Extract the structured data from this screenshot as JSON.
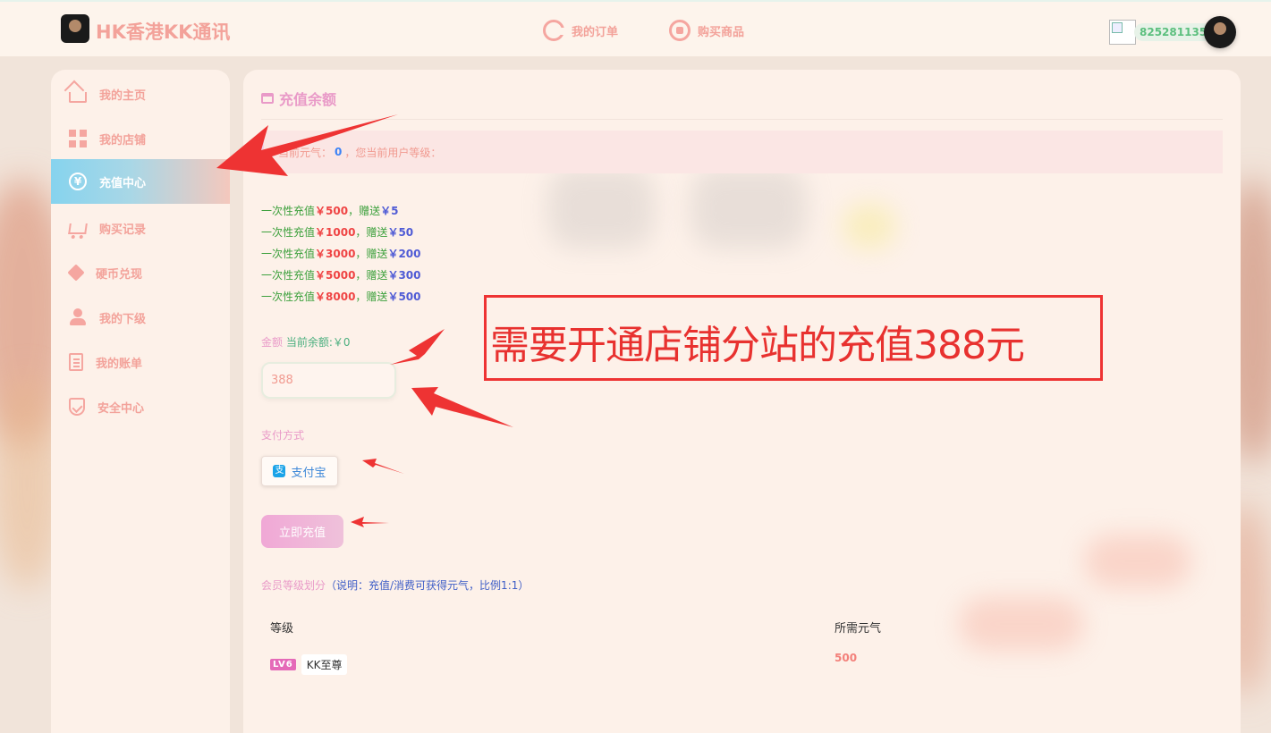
{
  "header": {
    "logo_text": "HK香港KK通讯",
    "nav": [
      {
        "label": "我的订单",
        "icon": "order-icon"
      },
      {
        "label": "购买商品",
        "icon": "cart-icon"
      }
    ],
    "user_id": "825281135"
  },
  "sidebar": {
    "items": [
      {
        "label": "我的主页",
        "icon": "home-icon",
        "active": false
      },
      {
        "label": "我的店铺",
        "icon": "store-icon",
        "active": false
      },
      {
        "label": "充值中心",
        "icon": "yen-icon",
        "active": true
      },
      {
        "label": "购买记录",
        "icon": "cart-icon",
        "active": false
      },
      {
        "label": "硬币兑现",
        "icon": "diamond-icon",
        "active": false
      },
      {
        "label": "我的下级",
        "icon": "person-icon",
        "active": false
      },
      {
        "label": "我的账单",
        "icon": "bill-icon",
        "active": false
      },
      {
        "label": "安全中心",
        "icon": "shield-icon",
        "active": false
      }
    ]
  },
  "main": {
    "title": "充值余额",
    "notice": {
      "prefix": "当前元气：",
      "value": "0",
      "suffix": "，您当前用户等级："
    },
    "promos": [
      {
        "text": "一次性充值",
        "amount": "￥500",
        "mid": "，赠送",
        "bonus": "￥5"
      },
      {
        "text": "一次性充值",
        "amount": "￥1000",
        "mid": "，赠送",
        "bonus": "￥50"
      },
      {
        "text": "一次性充值",
        "amount": "￥3000",
        "mid": "，赠送",
        "bonus": "￥200"
      },
      {
        "text": "一次性充值",
        "amount": "￥5000",
        "mid": "，赠送",
        "bonus": "￥300"
      },
      {
        "text": "一次性充值",
        "amount": "￥8000",
        "mid": "，赠送",
        "bonus": "￥500"
      }
    ],
    "amount_label": "金额",
    "balance_label": "当前余额:￥0",
    "amount_value": "388",
    "pay_label": "支付方式",
    "pay_method": "支付宝",
    "submit_label": "立即充值",
    "level_title": "会员等级划分",
    "level_note": "（说明：充值/消费可获得元气，比例1:1）",
    "table_headers": [
      "等级",
      "所需元气"
    ],
    "levels": [
      {
        "badge": "LV6",
        "name": "KK至尊",
        "required": "500"
      }
    ]
  },
  "annotation": {
    "text": "需要开通店铺分站的充值388元"
  },
  "colors": {
    "accent_pink": "#e99ac8",
    "salmon": "#f3a29a",
    "annotation_red": "#ee3333"
  }
}
